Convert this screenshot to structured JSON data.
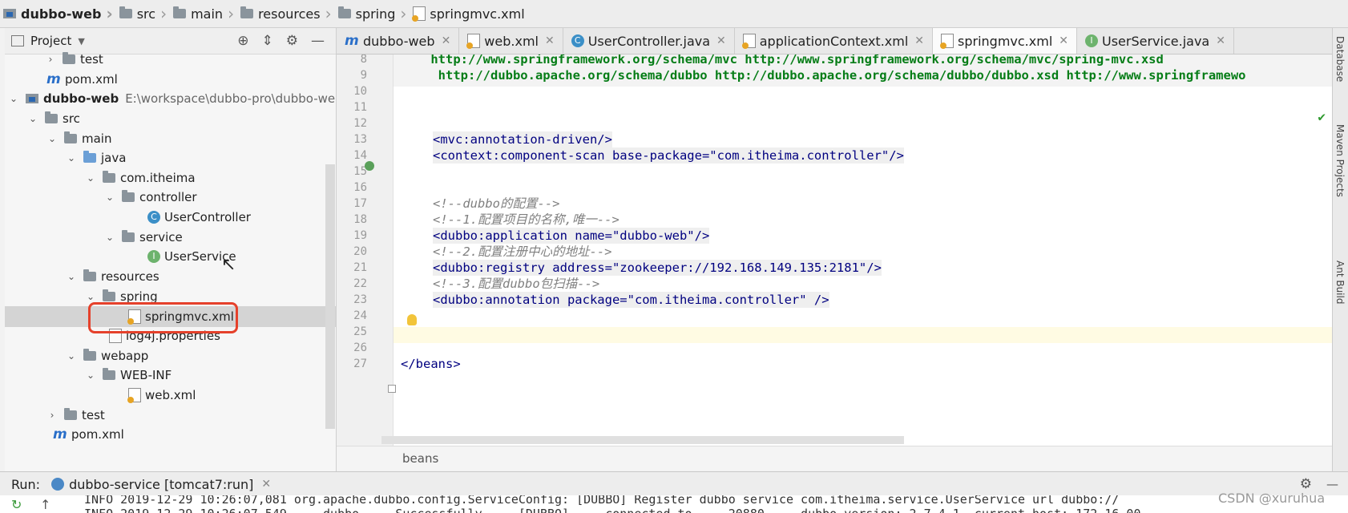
{
  "breadcrumb": [
    {
      "label": "dubbo-web",
      "bold": true
    },
    {
      "label": "src"
    },
    {
      "label": "main"
    },
    {
      "label": "resources"
    },
    {
      "label": "spring"
    },
    {
      "label": "springmvc.xml"
    }
  ],
  "project_panel": {
    "title": "Project",
    "tree": [
      {
        "label": "test",
        "icon": "folder-icon",
        "arrow": "›"
      },
      {
        "label": "pom.xml",
        "icon": "maven-icon"
      },
      {
        "label": "dubbo-web",
        "path": "E:\\workspace\\dubbo-pro\\dubbo-we",
        "icon": "module-icon",
        "arrow": "⌄"
      },
      {
        "label": "src",
        "icon": "folder-icon",
        "arrow": "⌄"
      },
      {
        "label": "main",
        "icon": "folder-icon",
        "arrow": "⌄"
      },
      {
        "label": "java",
        "icon": "source-folder-icon",
        "arrow": "⌄"
      },
      {
        "label": "com.itheima",
        "icon": "package-icon",
        "arrow": "⌄"
      },
      {
        "label": "controller",
        "icon": "package-icon",
        "arrow": "⌄"
      },
      {
        "label": "UserController",
        "icon": "class-icon"
      },
      {
        "label": "service",
        "icon": "package-icon",
        "arrow": "⌄"
      },
      {
        "label": "UserService",
        "icon": "interface-icon"
      },
      {
        "label": "resources",
        "icon": "resources-folder-icon",
        "arrow": "⌄"
      },
      {
        "label": "spring",
        "icon": "folder-icon",
        "arrow": "⌄"
      },
      {
        "label": "springmvc.xml",
        "icon": "xml-icon",
        "selected": true
      },
      {
        "label": "log4j.properties",
        "icon": "properties-icon"
      },
      {
        "label": "webapp",
        "icon": "folder-icon",
        "arrow": "⌄"
      },
      {
        "label": "WEB-INF",
        "icon": "folder-icon",
        "arrow": "⌄"
      },
      {
        "label": "web.xml",
        "icon": "xml-icon"
      },
      {
        "label": "test",
        "icon": "folder-icon",
        "arrow": "›"
      },
      {
        "label": "pom.xml",
        "icon": "maven-icon"
      }
    ]
  },
  "tabs": [
    {
      "label": "dubbo-web",
      "icon": "maven-icon"
    },
    {
      "label": "web.xml",
      "icon": "xml-icon"
    },
    {
      "label": "UserController.java",
      "icon": "class-icon"
    },
    {
      "label": "applicationContext.xml",
      "icon": "xml-icon"
    },
    {
      "label": "springmvc.xml",
      "icon": "xml-icon",
      "active": true
    },
    {
      "label": "UserService.java",
      "icon": "interface-icon"
    }
  ],
  "editor": {
    "lines": [
      {
        "n": "8",
        "text": "    http://www.springframework.org/schema/mvc http://www.springframework.org/schema/mvc/spring-mvc.xsd"
      },
      {
        "n": "9",
        "text": "     http://dubbo.apache.org/schema/dubbo http://dubbo.apache.org/schema/dubbo/dubbo.xsd http://www.springframewo"
      },
      {
        "n": "10",
        "text": ""
      },
      {
        "n": "11",
        "text": ""
      },
      {
        "n": "12",
        "text": ""
      },
      {
        "n": "13",
        "text": "<mvc:annotation-driven/>"
      },
      {
        "n": "14",
        "text": "<context:component-scan base-package=\"com.itheima.controller\"/>"
      },
      {
        "n": "15",
        "text": ""
      },
      {
        "n": "16",
        "text": ""
      },
      {
        "n": "17",
        "text": "<!--dubbo的配置-->"
      },
      {
        "n": "18",
        "text": "<!--1.配置项目的名称,唯一-->"
      },
      {
        "n": "19",
        "text": "<dubbo:application name=\"dubbo-web\"/>"
      },
      {
        "n": "20",
        "text": "<!--2.配置注册中心的地址-->"
      },
      {
        "n": "21",
        "text": "<dubbo:registry address=\"zookeeper://192.168.149.135:2181\"/>"
      },
      {
        "n": "22",
        "text": "<!--3.配置dubbo包扫描-->"
      },
      {
        "n": "23",
        "text": "<dubbo:annotation package=\"com.itheima.controller\" />"
      },
      {
        "n": "24",
        "text": ""
      },
      {
        "n": "25",
        "text": ""
      },
      {
        "n": "26",
        "text": ""
      },
      {
        "n": "27",
        "text": "</beans>"
      }
    ],
    "status_breadcrumb": "beans"
  },
  "right_strip": [
    "Database",
    "Maven Projects",
    "Ant Build"
  ],
  "run_bar": {
    "label": "Run:",
    "tab": "dubbo-service [tomcat7:run]",
    "console_line1": "INFO 2019-12-29 10:26:07,081 org.apache.dubbo.config.ServiceConfig:  [DUBBO] Register dubbo service com.itheima.service.UserService url dubbo://",
    "console_line2": "INFO 2019-12-29 10:26:07,549 ... dubbo ... Successfully ... [DUBBO] ... connected to ... 20880 ... dubbo version: 2.7.4.1, current host: 172.16.00"
  },
  "watermark": "CSDN @xuruhua",
  "colors": {
    "highlight_box": "#e5412b",
    "string": "#067d17",
    "tag": "#000080",
    "attribute": "#0000ff",
    "comment": "#808080"
  }
}
